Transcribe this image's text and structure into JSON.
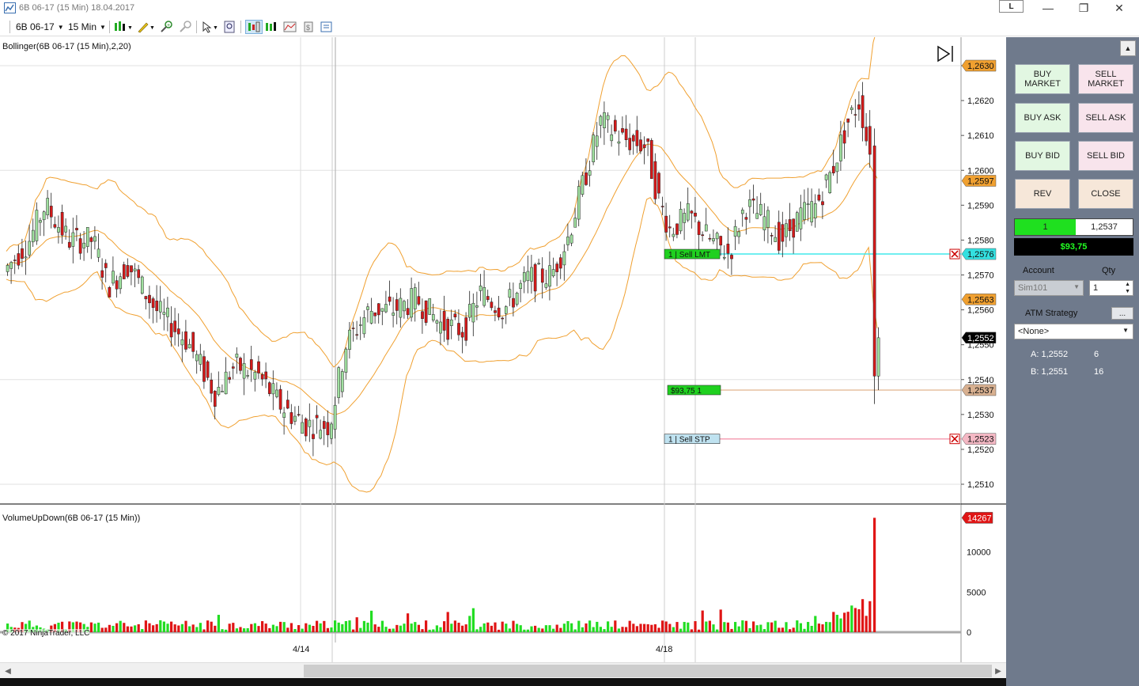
{
  "window": {
    "title": "6B 06-17 (15 Min)  18.04.2017",
    "link_label": "L",
    "minimize": "—",
    "restore": "❐",
    "close": "✕"
  },
  "toolbar": {
    "instrument": "6B 06-17",
    "interval": "15 Min"
  },
  "chart_data": {
    "type": "candlestick",
    "instrument": "6B 06-17",
    "interval": "15 Min",
    "date": "18.04.2017",
    "indicator_label": "Bollinger(6B 06-17 (15 Min),2,20)",
    "ylim": [
      1.2503,
      1.2634
    ],
    "y_ticks": [
      "1,2630",
      "1,2620",
      "1,2610",
      "1,2600",
      "1,2590",
      "1,2580",
      "1,2570",
      "1,2560",
      "1,2550",
      "1,2540",
      "1,2530",
      "1,2520",
      "1,2510"
    ],
    "x_ticks": [
      "4/14",
      "4/18"
    ],
    "price_markers": [
      {
        "label": "1,2630",
        "value": 1.263,
        "color": "#f0a030"
      },
      {
        "label": "1,2597",
        "value": 1.2597,
        "color": "#f0a030"
      },
      {
        "label": "1,2576",
        "value": 1.2576,
        "color": "#33e0e0"
      },
      {
        "label": "1,2563",
        "value": 1.2563,
        "color": "#f0a030"
      },
      {
        "label": "1,2552",
        "value": 1.2552,
        "color": "#000000"
      },
      {
        "label": "1,2537",
        "value": 1.2537,
        "color": "#d8b090"
      },
      {
        "label": "1,2523",
        "value": 1.2523,
        "color": "#f4b8c4"
      }
    ],
    "orders": [
      {
        "qty": "1",
        "label": "Sell LMT",
        "price": 1.2576,
        "color": "#1fd01f",
        "line": "#40e8ec"
      },
      {
        "qty": "1",
        "label": "Sell STP",
        "price": 1.2523,
        "color": "#bfe2f0",
        "line": "#f5a0b4"
      }
    ],
    "position": {
      "pnl": "$93,75",
      "qty": "1",
      "price": 1.2537
    },
    "volume": {
      "label": "VolumeUpDown(6B 06-17 (15 Min))",
      "ylim": [
        0,
        15000
      ],
      "y_ticks": [
        "10000",
        "5000",
        "0"
      ],
      "last": "14267"
    },
    "copyright": "© 2017 NinjaTrader, LLC"
  },
  "panel": {
    "buy_market": "BUY\nMARKET",
    "sell_market": "SELL\nMARKET",
    "buy_ask": "BUY ASK",
    "sell_ask": "SELL ASK",
    "buy_bid": "BUY BID",
    "sell_bid": "SELL BID",
    "rev": "REV",
    "close": "CLOSE",
    "position_qty": "1",
    "position_price": "1,2537",
    "pnl": "$93,75",
    "account_label": "Account",
    "qty_label": "Qty",
    "account_value": "Sim101",
    "qty_value": "1",
    "atm_label": "ATM Strategy",
    "atm_button": "...",
    "atm_value": "<None>",
    "ask_label": "A: 1,2552",
    "ask_size": "6",
    "bid_label": "B: 1,2551",
    "bid_size": "16"
  }
}
